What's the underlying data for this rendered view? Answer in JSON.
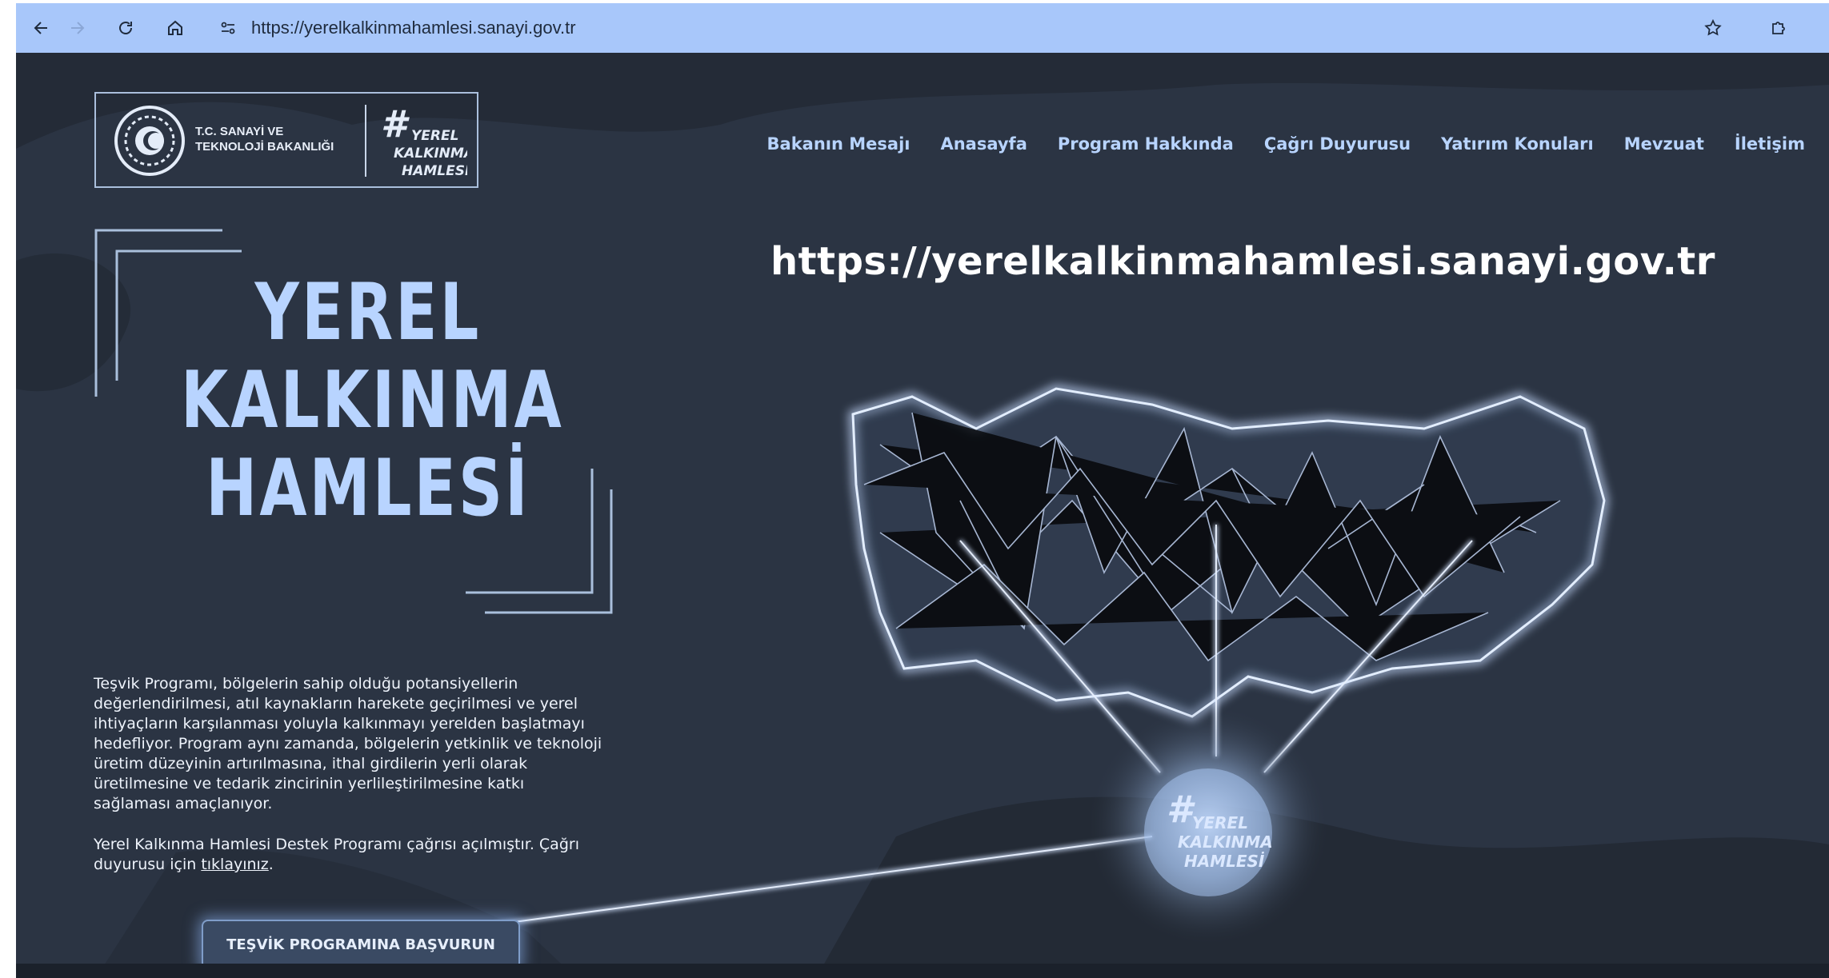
{
  "browser": {
    "url": "https://yerelkalkinmahamlesi.sanayi.gov.tr",
    "back_icon": "arrow-left-icon",
    "forward_icon": "arrow-right-icon",
    "reload_icon": "reload-icon",
    "home_icon": "home-icon",
    "site_info_icon": "site-settings-icon",
    "bookmark_icon": "star-icon",
    "extensions_icon": "puzzle-icon"
  },
  "header": {
    "ministry_name_line1": "T.C. SANAYİ VE",
    "ministry_name_line2": "TEKNOLOJİ BAKANLIĞI",
    "logo_text": [
      "YEREL",
      "KALKINMA",
      "HAMLESİ"
    ]
  },
  "nav": {
    "items": [
      "Bakanın Mesajı",
      "Anasayfa",
      "Program Hakkında",
      "Çağrı Duyurusu",
      "Yatırım Konuları",
      "Mevzuat",
      "İletişim"
    ]
  },
  "headline_url": "https://yerelkalkinmahamlesi.sanayi.gov.tr",
  "hero": {
    "title_line1": "YEREL",
    "title_line2": "KALKINMA",
    "title_line3": "HAMLESİ",
    "paragraph": "Teşvik Programı, bölgelerin sahip olduğu potansiyellerin değerlendirilmesi, atıl kaynakların harekete geçirilmesi ve yerel ihtiyaçların karşılanması yoluyla kalkınmayı yerelden başlatmayı hedefliyor. Program aynı zamanda, bölgelerin yetkinlik ve teknoloji üretim düzeyinin artırılmasına, ithal girdilerin yerli olarak üretilmesine ve tedarik zincirinin yerlileştirilmesine katkı sağlaması amaçlanıyor.",
    "announcement_prefix": "Yerel Kalkınma Hamlesi Destek Programı çağrısı açılmıştır. Çağrı duyurusu için ",
    "announcement_link": "tıklayınız",
    "announcement_suffix": ".",
    "apply_button": "TEŞVİK PROGRAMINA BAŞVURUN"
  },
  "colors": {
    "chrome_bar": "#a8c7fa",
    "page_bg": "#2b3443",
    "accent_blue": "#b8d4ff"
  }
}
